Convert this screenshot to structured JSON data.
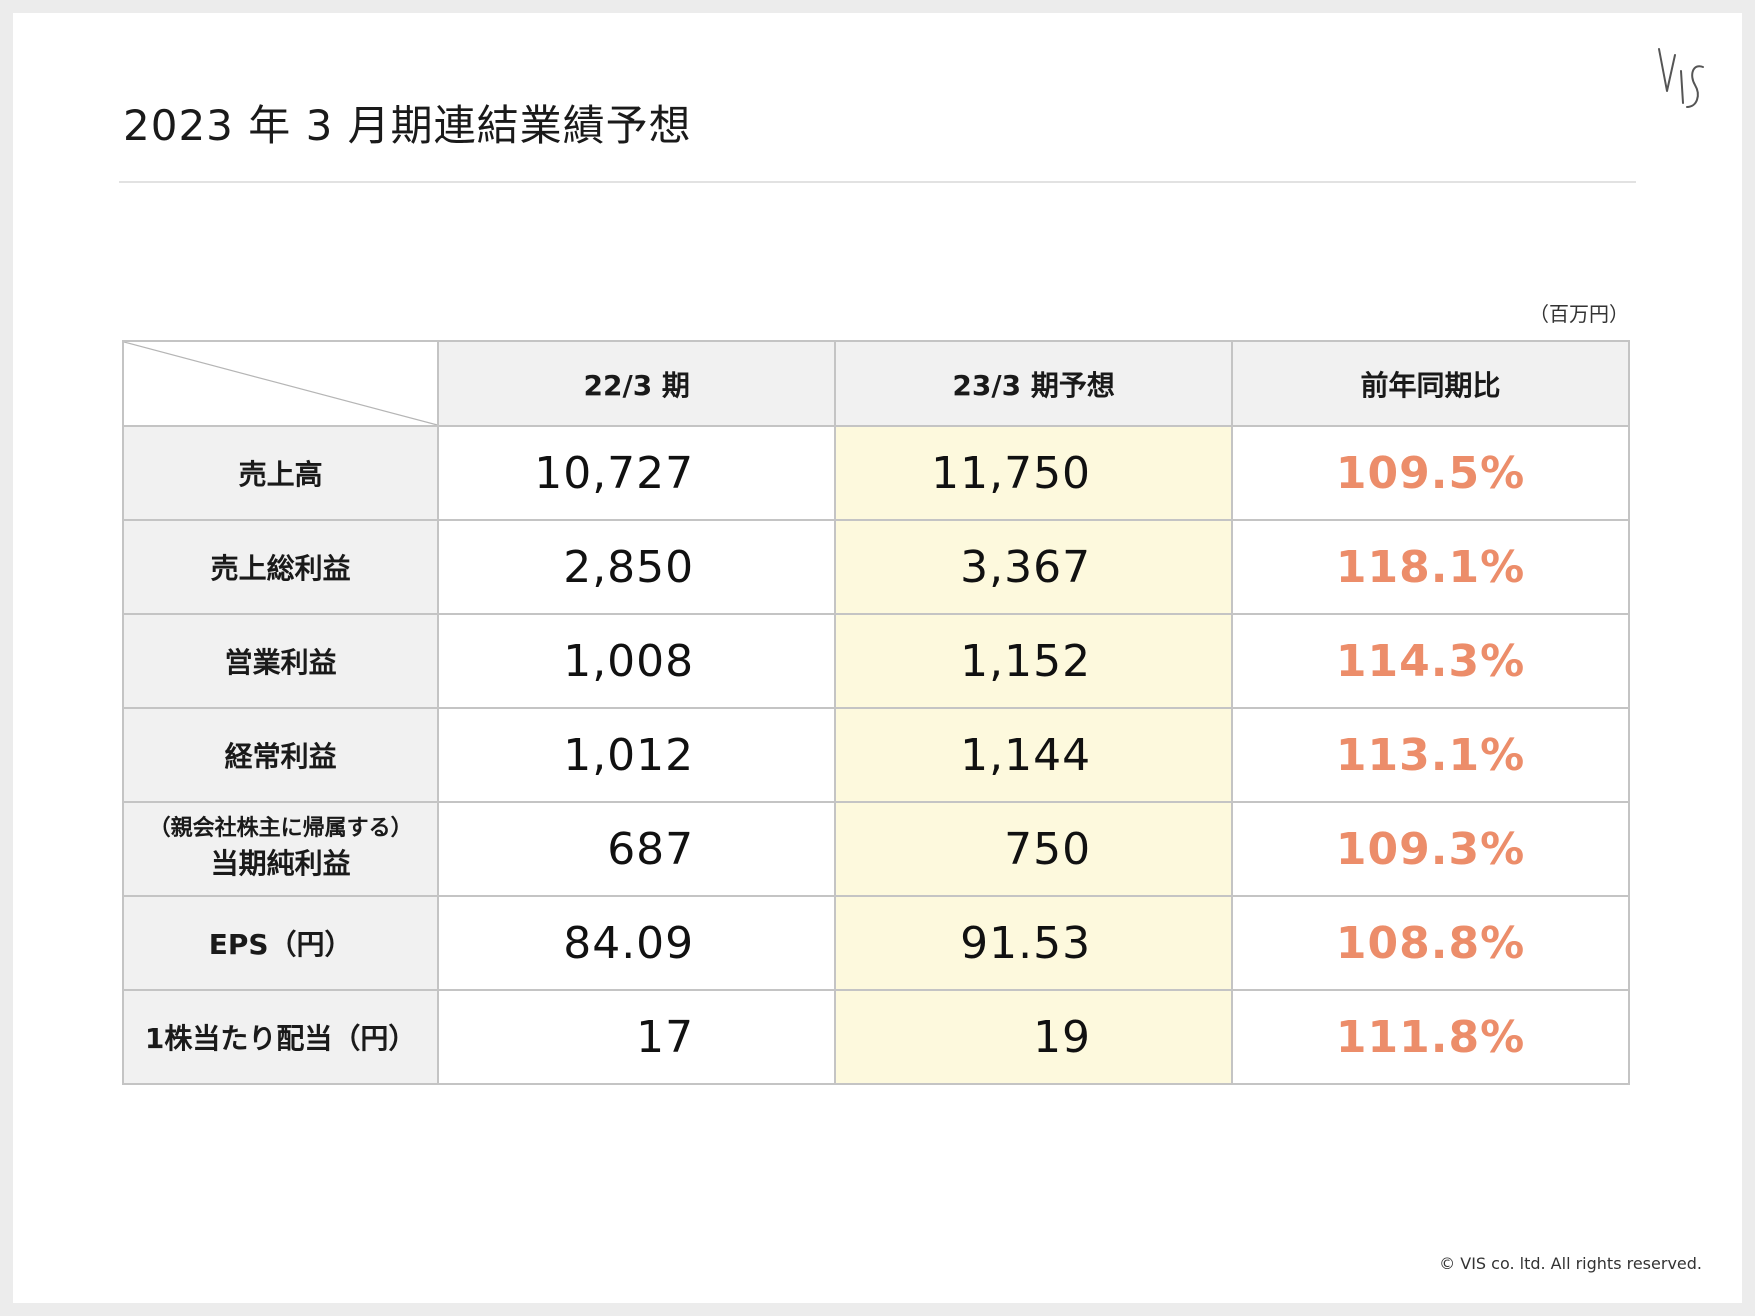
{
  "header": {
    "title": "2023 年 3 月期連結業績予想",
    "logo_text": "VIS"
  },
  "table": {
    "unit": "（百万円）",
    "columns": [
      "22/3 期",
      "23/3 期予想",
      "前年同期比"
    ],
    "rows": [
      {
        "label": "売上高",
        "prior": "10,727",
        "forecast": "11,750",
        "ratio": "109.5%"
      },
      {
        "label": "売上総利益",
        "prior": "2,850",
        "forecast": "3,367",
        "ratio": "118.1%"
      },
      {
        "label": "営業利益",
        "prior": "1,008",
        "forecast": "1,152",
        "ratio": "114.3%"
      },
      {
        "label": "経常利益",
        "prior": "1,012",
        "forecast": "1,144",
        "ratio": "113.1%"
      },
      {
        "label_prefix": "（親会社株主に帰属する）",
        "label": "当期純利益",
        "prior": "687",
        "forecast": "750",
        "ratio": "109.3%"
      },
      {
        "label": "EPS（円）",
        "prior": "84.09",
        "forecast": "91.53",
        "ratio": "108.8%"
      },
      {
        "label": "1株当たり配当（円）",
        "prior": "17",
        "forecast": "19",
        "ratio": "111.8%"
      }
    ]
  },
  "footer": {
    "copyright": "© VIS co. ltd. All rights reserved."
  },
  "colors": {
    "ratio_text": "#ec8d6a",
    "forecast_fill": "#fdf9dd",
    "header_fill": "#f1f1f1",
    "border": "#c4c4c4"
  }
}
